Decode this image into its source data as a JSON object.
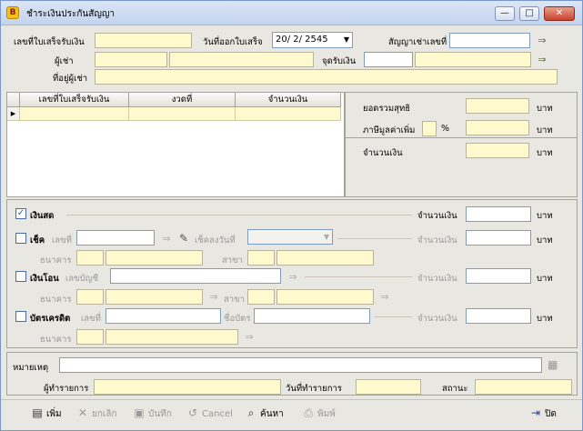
{
  "window": {
    "title": "ชำระเงินประกันสัญญา",
    "app_icon_glyph": "B",
    "minimize_glyph": "—",
    "maximize_glyph": "□",
    "close_glyph": "✕"
  },
  "header": {
    "receipt_no_label": "เลขที่ใบเสร็จรับเงิน",
    "receipt_no_value": "",
    "issue_date_label": "วันที่ออกใบเสร็จ",
    "issue_date_value": "20/ 2/ 2545",
    "contract_no_label": "สัญญาเช่าเลขที่",
    "contract_no_value": "",
    "tenant_label": "ผู้เช่า",
    "tenant_code": "",
    "tenant_name": "",
    "pay_point_label": "จุดรับเงิน",
    "pay_point_code": "",
    "pay_point_name": "",
    "address_label": "ที่อยู่ผู้เช่า",
    "address_value": ""
  },
  "grid": {
    "columns": [
      "เลขที่ใบเสร็จรับเงิน",
      "งวดที่",
      "จำนวนเงิน"
    ]
  },
  "summary": {
    "net_total_label": "ยอดรวมสุทธิ",
    "net_total_value": "",
    "vat_label": "ภาษีมูลค่าเพิ่ม",
    "vat_percent_sign": "%",
    "vat_value": "",
    "amount_label": "จำนวนเงิน",
    "amount_value": "",
    "currency": "บาท"
  },
  "payment": {
    "cash": {
      "label": "เงินสด",
      "checked": true,
      "check_glyph": "✓",
      "amount_label": "จำนวนเงิน",
      "amount_value": "",
      "currency": "บาท"
    },
    "cheque": {
      "label": "เช็ค",
      "checked": false,
      "no_label": "เลขที่",
      "no_value": "",
      "clearing_date_label": "เช็คลงวันที่",
      "date_value": "",
      "amount_label": "จำนวนเงิน",
      "amount_value": "",
      "currency": "บาท",
      "bank_label": "ธนาคาร",
      "branch_label": "สาขา"
    },
    "transfer": {
      "label": "เงินโอน",
      "checked": false,
      "account_label": "เลขบัญชี",
      "account_value": "",
      "amount_label": "จำนวนเงิน",
      "amount_value": "",
      "currency": "บาท",
      "bank_label": "ธนาคาร",
      "branch_label": "สาขา"
    },
    "credit_card": {
      "label": "บัตรเครดิต",
      "checked": false,
      "no_label": "เลขที่",
      "no_value": "",
      "card_name_label": "ชื่อบัตร",
      "card_name_value": "",
      "amount_label": "จำนวนเงิน",
      "amount_value": "",
      "currency": "บาท",
      "bank_label": "ธนาคาร"
    }
  },
  "footer": {
    "remark_label": "หมายเหตุ",
    "remark_value": "",
    "operator_label": "ผู้ทำรายการ",
    "operator_value": "",
    "txn_date_label": "วันที่ทำรายการ",
    "txn_date_value": "",
    "status_label": "สถานะ",
    "status_value": ""
  },
  "toolbar": {
    "add": "เพิ่ม",
    "cancel_record": "ยกเลิก",
    "save": "บันทึก",
    "cancel": "Cancel",
    "search": "ค้นหา",
    "print": "พิมพ์",
    "close": "ปิด"
  },
  "icons": {
    "picker_glyph": "⇒",
    "dropdown_glyph": "▼",
    "pen_glyph": "✎",
    "row_pointer_glyph": "▶",
    "add_glyph": "▤",
    "cancel_record_glyph": "✕",
    "save_glyph": "▣",
    "cancel_glyph": "↺",
    "search_glyph": "⌕",
    "print_glyph": "⎙",
    "close_glyph": "⇥",
    "note_glyph": "▦"
  }
}
